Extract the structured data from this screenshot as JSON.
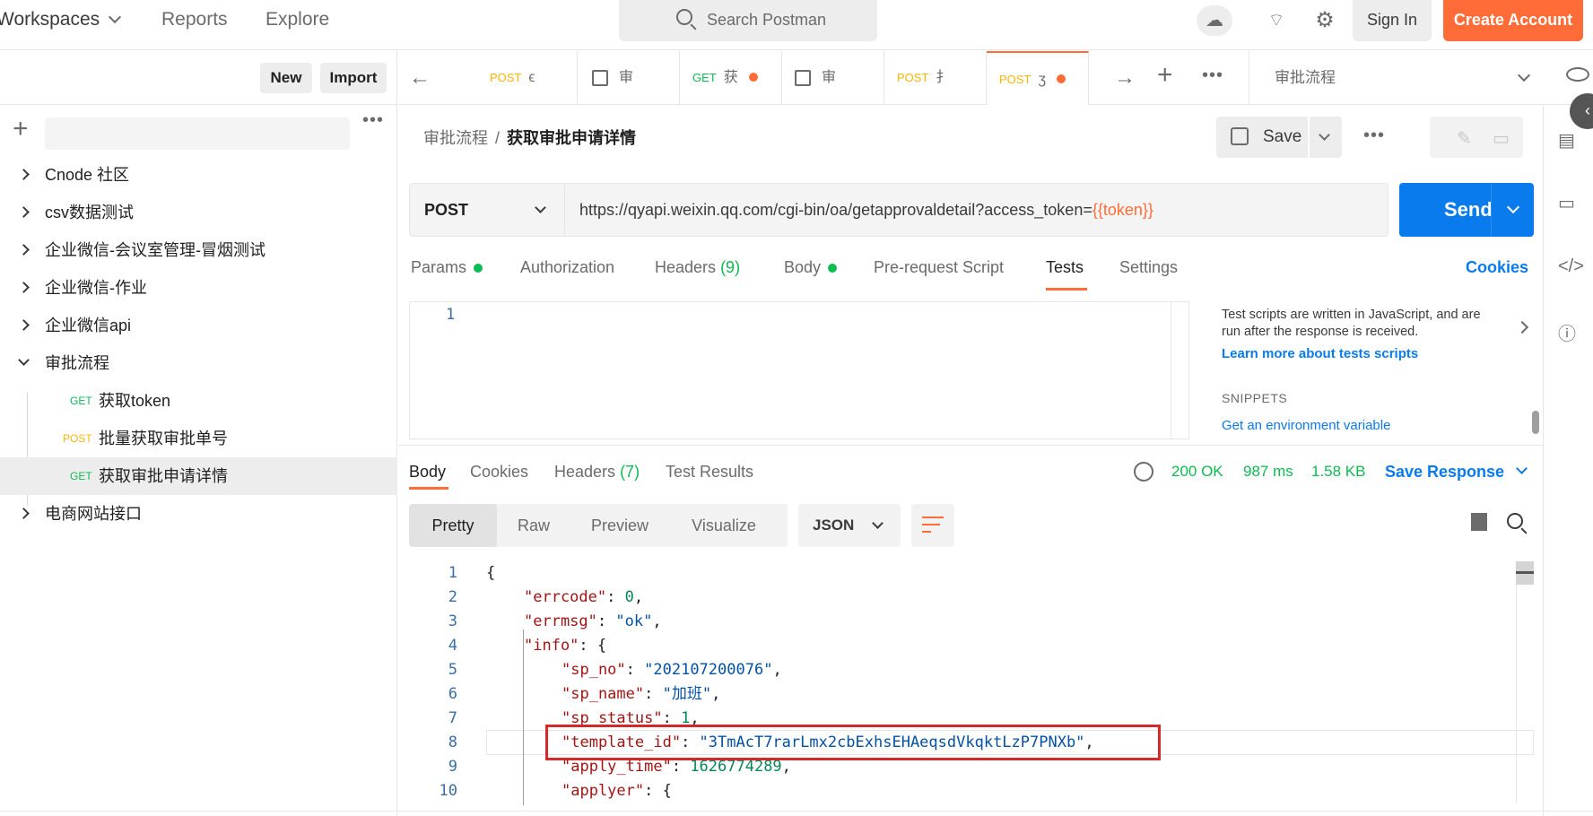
{
  "topbar": {
    "workspaces": "Workspaces",
    "reports": "Reports",
    "explore": "Explore",
    "search_placeholder": "Search Postman",
    "sign_in": "Sign In",
    "create_account": "Create Account",
    "accent_color": "#ff6c37"
  },
  "sidebar": {
    "new": "New",
    "import": "Import",
    "collections": [
      {
        "label": "Cnode 社区"
      },
      {
        "label": "csv数据测试"
      },
      {
        "label": "企业微信-会议室管理-冒烟测试"
      },
      {
        "label": "企业微信-作业"
      },
      {
        "label": "企业微信api"
      },
      {
        "label": "审批流程"
      }
    ],
    "requests": [
      {
        "method": "GET",
        "label": "获取token"
      },
      {
        "method": "POST",
        "label": "批量获取审批单号"
      },
      {
        "method": "GET",
        "label": "获取审批申请详情"
      }
    ],
    "last_collection": "电商网站接口"
  },
  "tabs": [
    {
      "method": "POST",
      "label": "ϵ"
    },
    {
      "method": "",
      "label": "审"
    },
    {
      "method": "GET",
      "label": "获"
    },
    {
      "method": "",
      "label": "审"
    },
    {
      "method": "POST",
      "label": "扌"
    },
    {
      "method": "POST",
      "label": "ʒ"
    }
  ],
  "environment": "审批流程",
  "breadcrumb": {
    "collection": "审批流程",
    "separator": "/",
    "request": "获取审批申请详情"
  },
  "save_label": "Save",
  "request": {
    "method": "POST",
    "url_base": "https://qyapi.weixin.qq.com/cgi-bin/oa/getapprovaldetail?access_token=",
    "url_var": "{{token}}",
    "send": "Send"
  },
  "request_tabs": {
    "params": "Params",
    "authorization": "Authorization",
    "headers": "Headers",
    "headers_count": "(9)",
    "body": "Body",
    "prerequest": "Pre-request Script",
    "tests": "Tests",
    "settings": "Settings",
    "cookies": "Cookies"
  },
  "editor": {
    "line": "1",
    "help_text": "Test scripts are written in JavaScript, and are run after the response is received.",
    "help_link": "Learn more about tests scripts",
    "snippets_title": "SNIPPETS",
    "snippet_1": "Get an environment variable"
  },
  "response": {
    "tabs": {
      "body": "Body",
      "cookies": "Cookies",
      "headers": "Headers",
      "headers_count": "(7)",
      "test_results": "Test Results"
    },
    "status": "200 OK",
    "time": "987 ms",
    "size": "1.58 KB",
    "save_response": "Save Response",
    "views": [
      "Pretty",
      "Raw",
      "Preview",
      "Visualize"
    ],
    "format": "JSON"
  },
  "code_lines": [
    {
      "n": "1",
      "text": "{"
    },
    {
      "n": "2",
      "key": "\"errcode\"",
      "val": "0",
      "type": "num"
    },
    {
      "n": "3",
      "key": "\"errmsg\"",
      "val": "\"ok\"",
      "type": "str"
    },
    {
      "n": "4",
      "key": "\"info\"",
      "val": "{",
      "type": "open"
    },
    {
      "n": "5",
      "key": "\"sp_no\"",
      "val": "\"202107200076\"",
      "type": "str"
    },
    {
      "n": "6",
      "key": "\"sp_name\"",
      "val": "\"加班\"",
      "type": "str"
    },
    {
      "n": "7",
      "key": "\"sp_status\"",
      "val": "1",
      "type": "num"
    },
    {
      "n": "8",
      "key": "\"template_id\"",
      "val": "\"3TmAcT7rarLmx2cbExhsEHAeqsdVkqktLzP7PNXb\"",
      "type": "str"
    },
    {
      "n": "9",
      "key": "\"apply_time\"",
      "val": "1626774289",
      "type": "num"
    },
    {
      "n": "10",
      "key": "\"applyer\"",
      "val": "{",
      "type": "open"
    }
  ]
}
